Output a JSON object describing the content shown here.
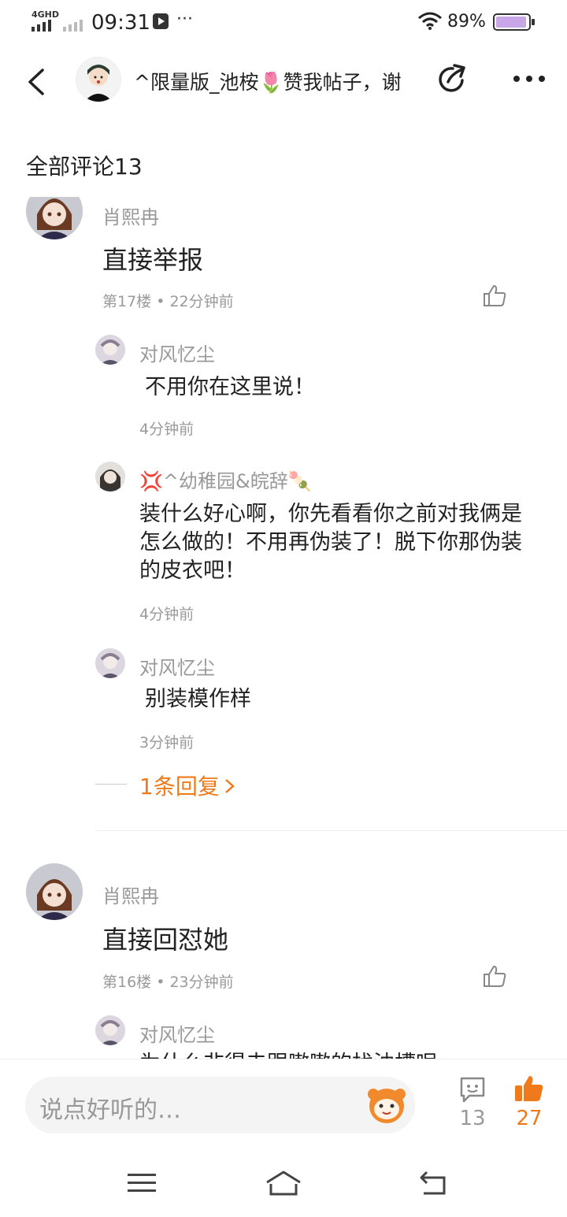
{
  "status_bar": {
    "network": "4GHD",
    "time": "09:31",
    "more": "···",
    "battery": "89%"
  },
  "header": {
    "title": "^限量版_池桉🌷赞我帖子，谢"
  },
  "section": {
    "title": "全部评论13"
  },
  "comments": [
    {
      "username": "肖熙冉",
      "content": "直接举报",
      "floor_time": "第17楼 • 22分钟前",
      "replies": [
        {
          "username": "对风忆尘",
          "content": "不用你在这里说！",
          "time": "4分钟前"
        },
        {
          "username": "💢^幼稚园&皖辞🍡",
          "content": "装什么好心啊，你先看看你之前对我俩是怎么做的！不用再伪装了！脱下你那伪装的皮衣吧！",
          "time": "4分钟前"
        },
        {
          "username": "对风忆尘",
          "content": "别装模作样",
          "time": "3分钟前"
        }
      ],
      "more_replies": "1条回复"
    },
    {
      "username": "肖熙冉",
      "content": "直接回怼她",
      "floor_time": "第16楼 • 23分钟前",
      "replies": [
        {
          "username": "对风忆尘",
          "content": "为什么非得去跟嗷嗷的找油槽呢",
          "time": ""
        }
      ]
    }
  ],
  "bottom_bar": {
    "placeholder": "说点好听的…",
    "comment_count": "13",
    "like_count": "27"
  },
  "colors": {
    "accent": "#f07a1a",
    "meta_text": "#9a9a9a"
  }
}
